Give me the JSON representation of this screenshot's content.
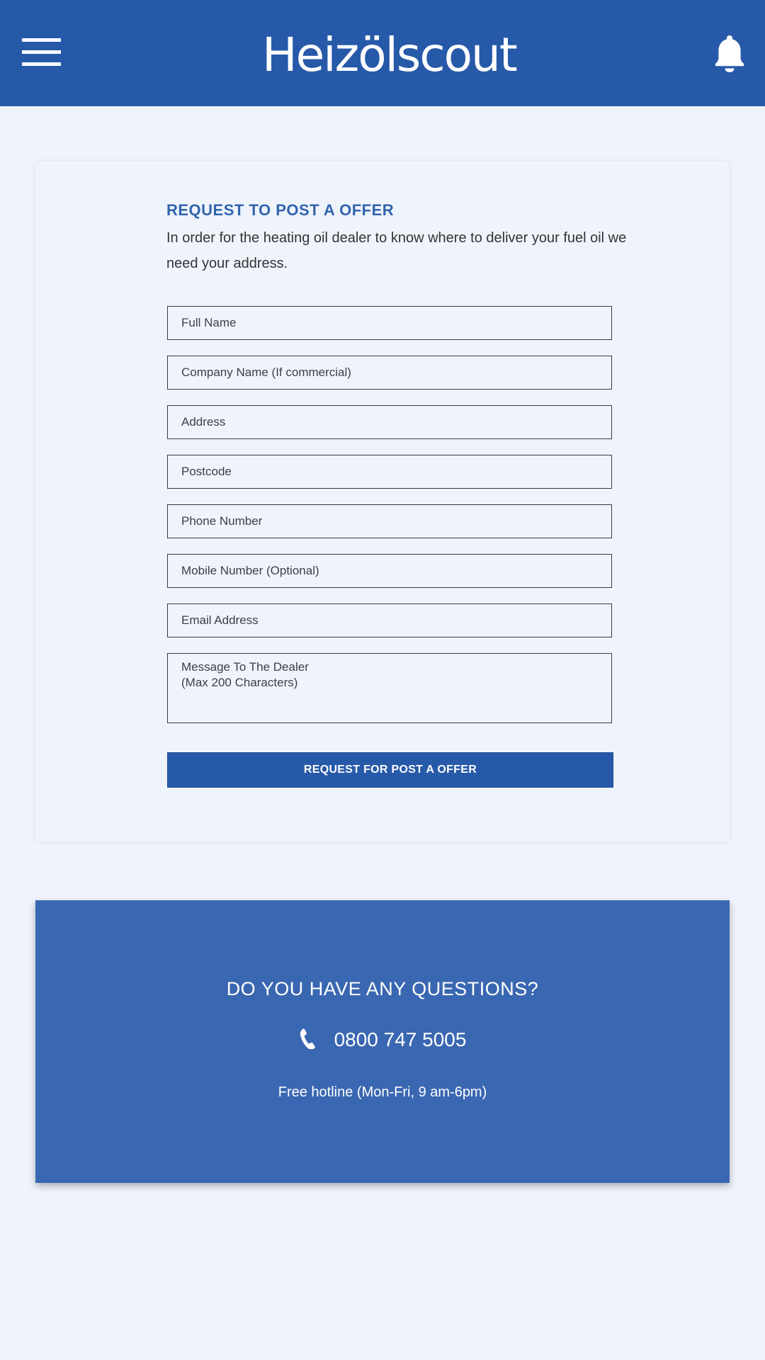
{
  "header": {
    "logo_text": "Heizölscout",
    "menu_icon": "hamburger-menu-icon",
    "notification_icon": "bell-icon",
    "background_color": "#2759a9"
  },
  "form": {
    "heading": "REQUEST TO POST A OFFER",
    "intro": "In order for the heating oil dealer to know where to deliver your fuel oil we need your address.",
    "fields": {
      "full_name": "Full Name",
      "company_name": "Company Name (If commercial)",
      "address": "Address",
      "postcode": "Postcode",
      "phone_number": "Phone Number",
      "mobile_number": "Mobile Number (Optional)",
      "email_address": "Email Address",
      "message": "Message To The Dealer\n(Max 200 Characters)"
    },
    "submit_label": "REQUEST FOR POST A OFFER",
    "accent_color": "#3264ad"
  },
  "contact": {
    "title": "DO YOU HAVE ANY QUESTIONS?",
    "phone": "0800 747 5005",
    "phone_icon": "phone-icon",
    "hotline_text": "Free hotline (Mon-Fri, 9 am-6pm)",
    "background_color": "#3a67b1"
  }
}
